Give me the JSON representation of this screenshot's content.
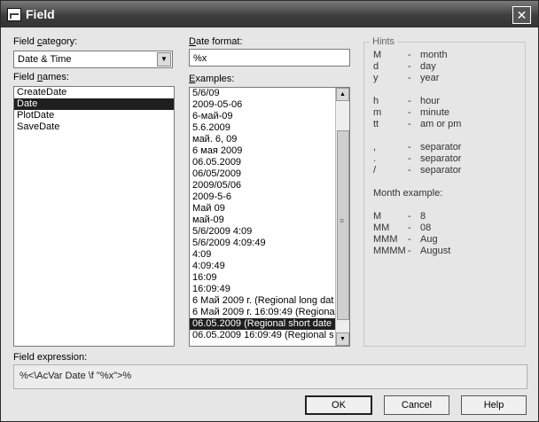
{
  "window": {
    "title": "Field",
    "close_glyph": "✕"
  },
  "field_category": {
    "label_pre": "Field ",
    "label_u": "c",
    "label_post": "ategory:",
    "value": "Date & Time"
  },
  "field_names": {
    "label_pre": "Field ",
    "label_u": "n",
    "label_post": "ames:",
    "items": [
      "CreateDate",
      "Date",
      "PlotDate",
      "SaveDate"
    ],
    "selected_index": 1
  },
  "date_format": {
    "label_u": "D",
    "label_post": "ate format:",
    "value": "%x"
  },
  "examples": {
    "label_u": "E",
    "label_post": "xamples:",
    "items": [
      "5/6/09",
      "2009-05-06",
      "6-май-09",
      "5.6.2009",
      "май. 6, 09",
      "6 мая 2009",
      "06.05.2009",
      "06/05/2009",
      "2009/05/06",
      "2009-5-6",
      "Май 09",
      "май-09",
      "5/6/2009 4:09",
      "5/6/2009 4:09:49",
      "4:09",
      "4:09:49",
      "16:09",
      "16:09:49",
      "6 Май 2009 г. (Regional long dat",
      "6 Май 2009 г. 16:09:49 (Regiona",
      "06.05.2009 (Regional short date",
      "06.05.2009 16:09:49 (Regional s"
    ],
    "selected_index": 20
  },
  "hints": {
    "title": "Hints",
    "rows": [
      {
        "k": "M",
        "d": "-",
        "v": "month"
      },
      {
        "k": "d",
        "d": "-",
        "v": "day"
      },
      {
        "k": "y",
        "d": "-",
        "v": "year"
      },
      {
        "k": "h",
        "d": "-",
        "v": "hour"
      },
      {
        "k": "m",
        "d": "-",
        "v": "minute"
      },
      {
        "k": "tt",
        "d": "-",
        "v": "am or pm"
      },
      {
        "k": ",",
        "d": "-",
        "v": "separator"
      },
      {
        "k": ".",
        "d": "-",
        "v": "separator"
      },
      {
        "k": "/",
        "d": "-",
        "v": "separator"
      }
    ],
    "month_example_label": "Month example:",
    "month_rows": [
      {
        "k": "M",
        "d": "-",
        "v": "8"
      },
      {
        "k": "MM",
        "d": "-",
        "v": "08"
      },
      {
        "k": "MMM",
        "d": "-",
        "v": "Aug"
      },
      {
        "k": "MMMM",
        "d": "-",
        "v": "August"
      }
    ]
  },
  "field_expression": {
    "label": "Field expression:",
    "value": "%<\\AcVar Date \\f \"%x\">%"
  },
  "buttons": {
    "ok": "OK",
    "cancel": "Cancel",
    "help": "Help"
  },
  "icons": {
    "app": "field-app-icon",
    "close": "close-icon",
    "dropdown": "chevron-down-icon"
  }
}
